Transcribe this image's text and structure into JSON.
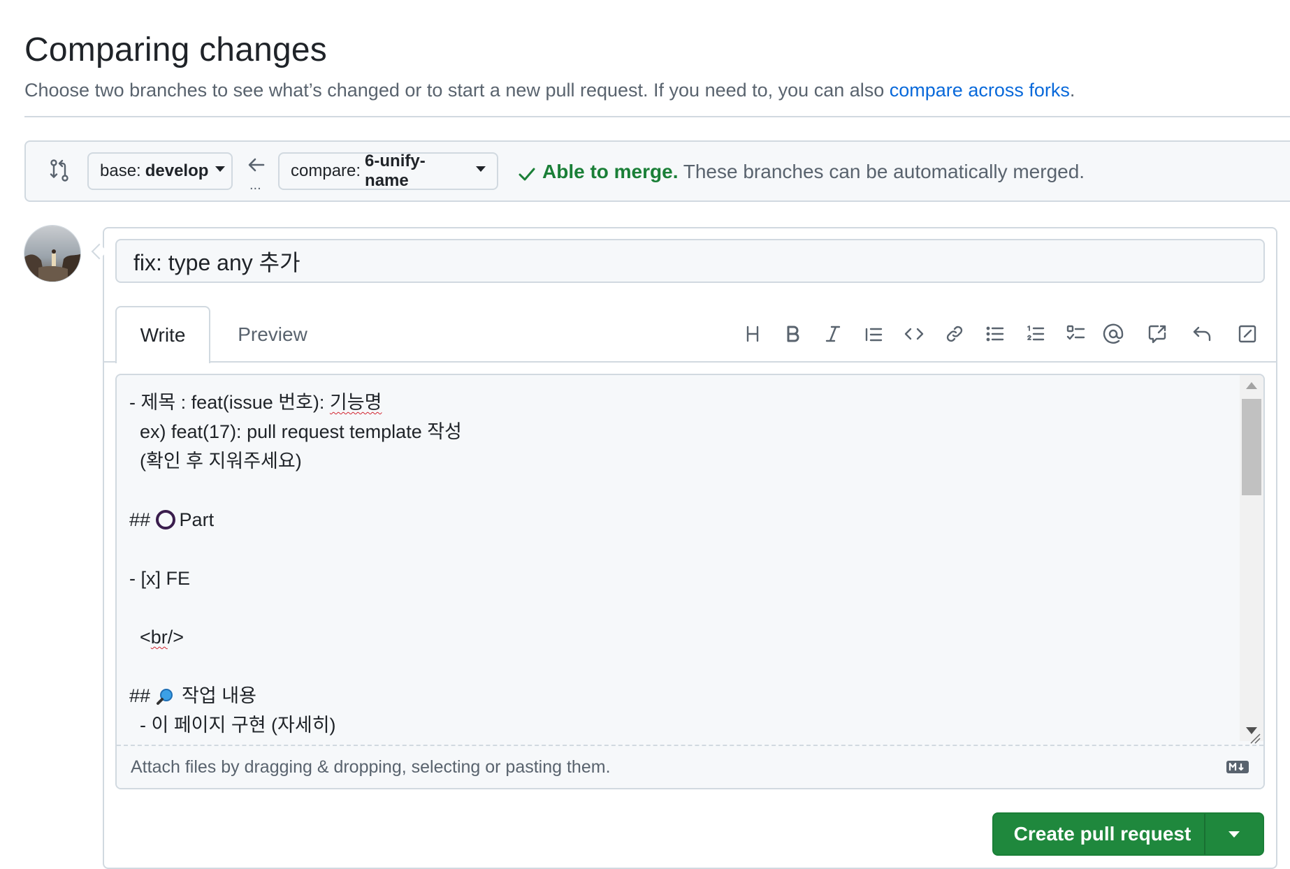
{
  "header": {
    "title": "Comparing changes",
    "subtitle_text": "Choose two branches to see what’s changed or to start a new pull request. If you need to, you can also ",
    "subtitle_link": "compare across forks",
    "subtitle_end": "."
  },
  "range": {
    "base_label": "base:",
    "base_branch": "develop",
    "ellipsis": "...",
    "compare_label": "compare:",
    "compare_branch": "6-unify-name",
    "merge_status": "Able to merge.",
    "merge_detail": " These branches can be automatically merged."
  },
  "form": {
    "title_value": "fix: type any 추가",
    "tabs": {
      "write": "Write",
      "preview": "Preview"
    },
    "toolbar": [
      "heading-icon",
      "bold-icon",
      "italic-icon",
      "quote-icon",
      "code-icon",
      "link-icon",
      "unordered-list-icon",
      "ordered-list-icon",
      "task-list-icon",
      "mention-icon",
      "reference-icon",
      "undo-icon",
      "fullscreen-icon"
    ],
    "body_lines": {
      "l1a": "- 제목 : feat(issue 번호): ",
      "l1b": "기능명",
      "l2": "  ex) feat(17): pull request template 작성",
      "l3": "  (확인 후 지워주세요)",
      "l5a": "## ",
      "l5b": "Part",
      "l7": "- [x] FE",
      "l9a": "  <",
      "l9b": "br",
      "l9c": "/>",
      "l11a": "## ",
      "l11b": " 작업 내용",
      "l12": "  - 이 페이지 구현 (자세히)"
    },
    "attach_text": "Attach files by dragging & dropping, selecting or pasting them.",
    "submit_label": "Create pull request"
  }
}
